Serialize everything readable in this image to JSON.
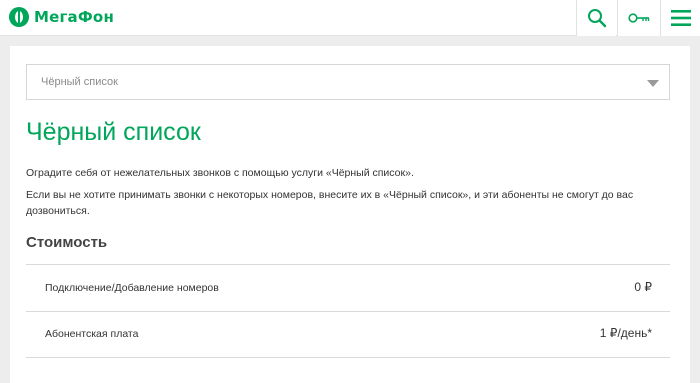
{
  "header": {
    "logo_text": "МегаФон",
    "brand_color": "#00a65a",
    "icons": [
      "search-icon",
      "key-icon",
      "menu-icon"
    ]
  },
  "dropdown": {
    "selected": "Чёрный список"
  },
  "content": {
    "title": "Чёрный список",
    "paragraph1": "Оградите себя от нежелательных звонков с помощью услуги «Чёрный список».",
    "paragraph2": "Если вы не хотите принимать звонки с некоторых номеров, внесите их в «Чёрный список», и эти абоненты не смогут до вас дозвониться.",
    "cost_heading": "Стоимость",
    "rows": [
      {
        "label": "Подключение/Добавление номеров",
        "value": "0 ₽"
      },
      {
        "label": "Абонентская плата",
        "value": "1 ₽/день*"
      }
    ]
  }
}
